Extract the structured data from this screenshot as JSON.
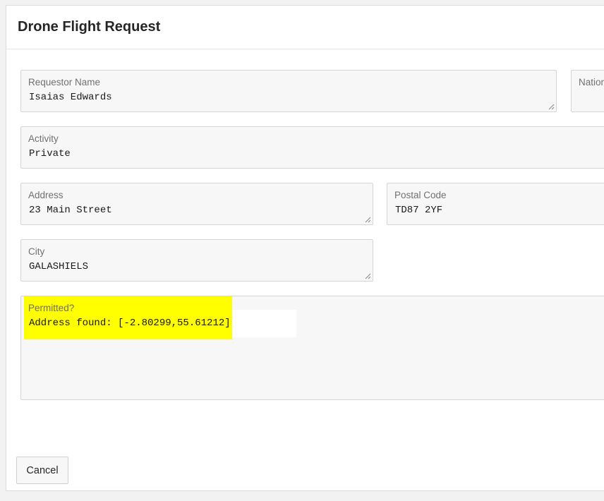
{
  "dialog": {
    "title": "Drone Flight Request"
  },
  "fields": {
    "requestor_name": {
      "label": "Requestor Name",
      "value": "Isaias Edwards"
    },
    "nationality": {
      "label": "Nation",
      "value": ""
    },
    "activity": {
      "label": "Activity",
      "value": "Private"
    },
    "address": {
      "label": "Address",
      "value": "23 Main Street"
    },
    "postal_code": {
      "label": "Postal Code",
      "value": "TD87 2YF"
    },
    "city": {
      "label": "City",
      "value": "GALASHIELS"
    },
    "permitted": {
      "label": "Permitted?",
      "value": "Address found: [-2.80299,55.61212]"
    }
  },
  "footer": {
    "cancel_label": "Cancel"
  },
  "colors": {
    "highlight": "#ffff00",
    "field_bg": "#f7f7f7",
    "field_border": "#d5d5d5"
  },
  "icons": {
    "resize": "resize-grip-icon"
  }
}
